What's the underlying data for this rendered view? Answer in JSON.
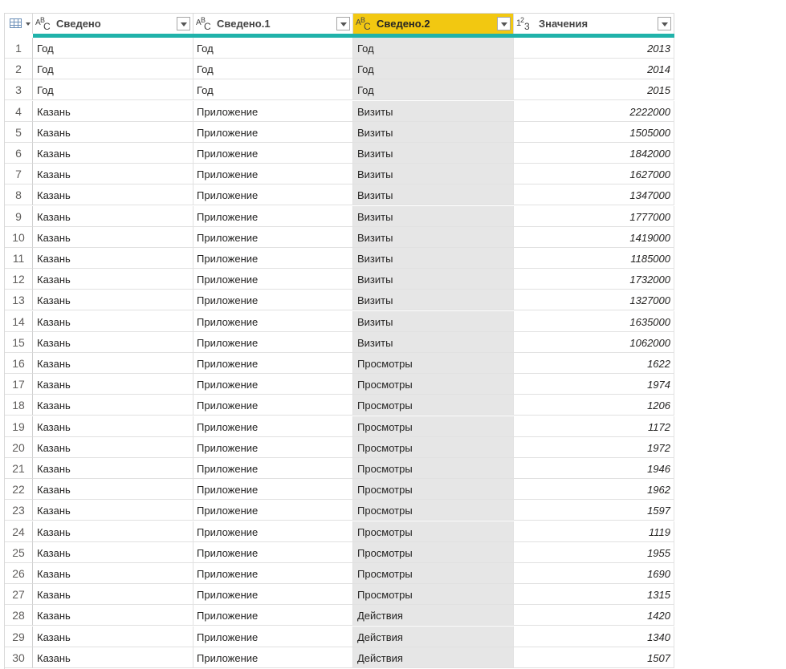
{
  "columns": [
    {
      "label": "Сведено",
      "type": "text"
    },
    {
      "label": "Сведено.1",
      "type": "text"
    },
    {
      "label": "Сведено.2",
      "type": "text",
      "selected": true
    },
    {
      "label": "Значения",
      "type": "number"
    }
  ],
  "type_icons": {
    "text": [
      "A",
      "B",
      "C"
    ],
    "number": [
      "1",
      "2",
      "3"
    ]
  },
  "colors": {
    "selected_header": "#f2c811",
    "quality_bar": "#20b2aa",
    "selected_column_bg": "#e6e6e6"
  },
  "rows": [
    [
      "1",
      "Год",
      "Год",
      "Год",
      "2013"
    ],
    [
      "2",
      "Год",
      "Год",
      "Год",
      "2014"
    ],
    [
      "3",
      "Год",
      "Год",
      "Год",
      "2015"
    ],
    [
      "4",
      "Казань",
      "Приложение",
      "Визиты",
      "2222000"
    ],
    [
      "5",
      "Казань",
      "Приложение",
      "Визиты",
      "1505000"
    ],
    [
      "6",
      "Казань",
      "Приложение",
      "Визиты",
      "1842000"
    ],
    [
      "7",
      "Казань",
      "Приложение",
      "Визиты",
      "1627000"
    ],
    [
      "8",
      "Казань",
      "Приложение",
      "Визиты",
      "1347000"
    ],
    [
      "9",
      "Казань",
      "Приложение",
      "Визиты",
      "1777000"
    ],
    [
      "10",
      "Казань",
      "Приложение",
      "Визиты",
      "1419000"
    ],
    [
      "11",
      "Казань",
      "Приложение",
      "Визиты",
      "1185000"
    ],
    [
      "12",
      "Казань",
      "Приложение",
      "Визиты",
      "1732000"
    ],
    [
      "13",
      "Казань",
      "Приложение",
      "Визиты",
      "1327000"
    ],
    [
      "14",
      "Казань",
      "Приложение",
      "Визиты",
      "1635000"
    ],
    [
      "15",
      "Казань",
      "Приложение",
      "Визиты",
      "1062000"
    ],
    [
      "16",
      "Казань",
      "Приложение",
      "Просмотры",
      "1622"
    ],
    [
      "17",
      "Казань",
      "Приложение",
      "Просмотры",
      "1974"
    ],
    [
      "18",
      "Казань",
      "Приложение",
      "Просмотры",
      "1206"
    ],
    [
      "19",
      "Казань",
      "Приложение",
      "Просмотры",
      "1172"
    ],
    [
      "20",
      "Казань",
      "Приложение",
      "Просмотры",
      "1972"
    ],
    [
      "21",
      "Казань",
      "Приложение",
      "Просмотры",
      "1946"
    ],
    [
      "22",
      "Казань",
      "Приложение",
      "Просмотры",
      "1962"
    ],
    [
      "23",
      "Казань",
      "Приложение",
      "Просмотры",
      "1597"
    ],
    [
      "24",
      "Казань",
      "Приложение",
      "Просмотры",
      "1119"
    ],
    [
      "25",
      "Казань",
      "Приложение",
      "Просмотры",
      "1955"
    ],
    [
      "26",
      "Казань",
      "Приложение",
      "Просмотры",
      "1690"
    ],
    [
      "27",
      "Казань",
      "Приложение",
      "Просмотры",
      "1315"
    ],
    [
      "28",
      "Казань",
      "Приложение",
      "Действия",
      "1420"
    ],
    [
      "29",
      "Казань",
      "Приложение",
      "Действия",
      "1340"
    ],
    [
      "30",
      "Казань",
      "Приложение",
      "Действия",
      "1507"
    ]
  ]
}
